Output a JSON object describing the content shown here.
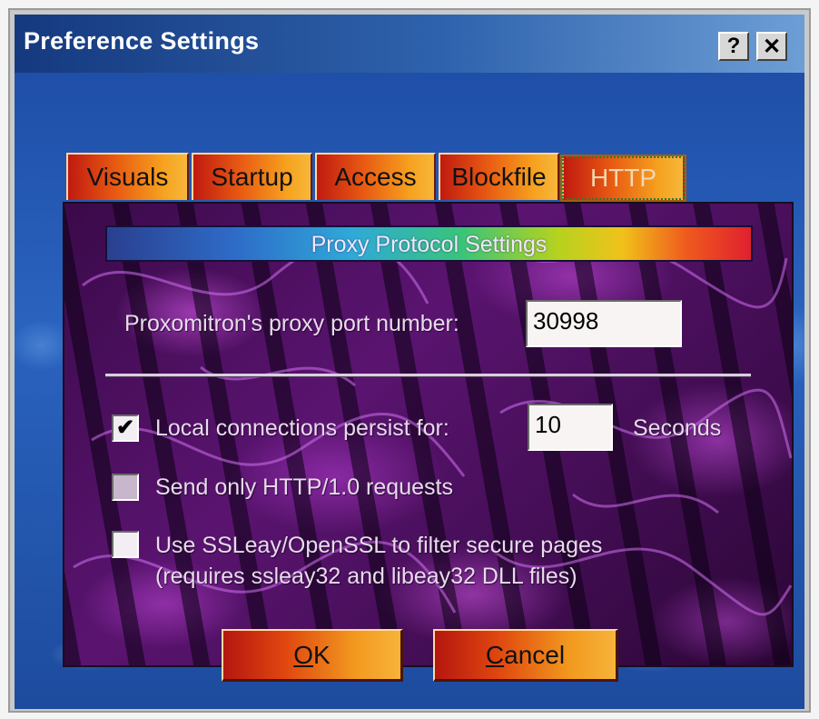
{
  "window": {
    "title": "Preference Settings",
    "help_label": "?",
    "close_label": "✕"
  },
  "tabs": [
    {
      "label": "Visuals",
      "active": false
    },
    {
      "label": "Startup",
      "active": false
    },
    {
      "label": "Access",
      "active": false
    },
    {
      "label": "Blockfile",
      "active": false
    },
    {
      "label": "HTTP",
      "active": true
    }
  ],
  "panel": {
    "section_title": "Proxy Protocol Settings",
    "port_label": "Proxomitron's proxy port number:",
    "port_value": "30998",
    "persist": {
      "checked": true,
      "label": "Local connections persist for:",
      "value": "10",
      "unit": "Seconds"
    },
    "http10": {
      "checked": false,
      "label": "Send only HTTP/1.0 requests"
    },
    "ssl": {
      "checked": false,
      "line1": "Use SSLeay/OpenSSL to filter secure pages",
      "line2": "(requires ssleay32 and libeay32 DLL files)"
    }
  },
  "buttons": {
    "ok_accel": "O",
    "ok_rest": "K",
    "cancel_accel": "C",
    "cancel_rest": "ancel"
  },
  "colors": {
    "titlebar": "#15397f",
    "tab_gradient_start": "#c01a10",
    "tab_gradient_end": "#f7b73a",
    "panel_bg": "#3b0a4a",
    "client_bg": "#2a63bf"
  },
  "icons": {
    "check": "check-icon"
  }
}
